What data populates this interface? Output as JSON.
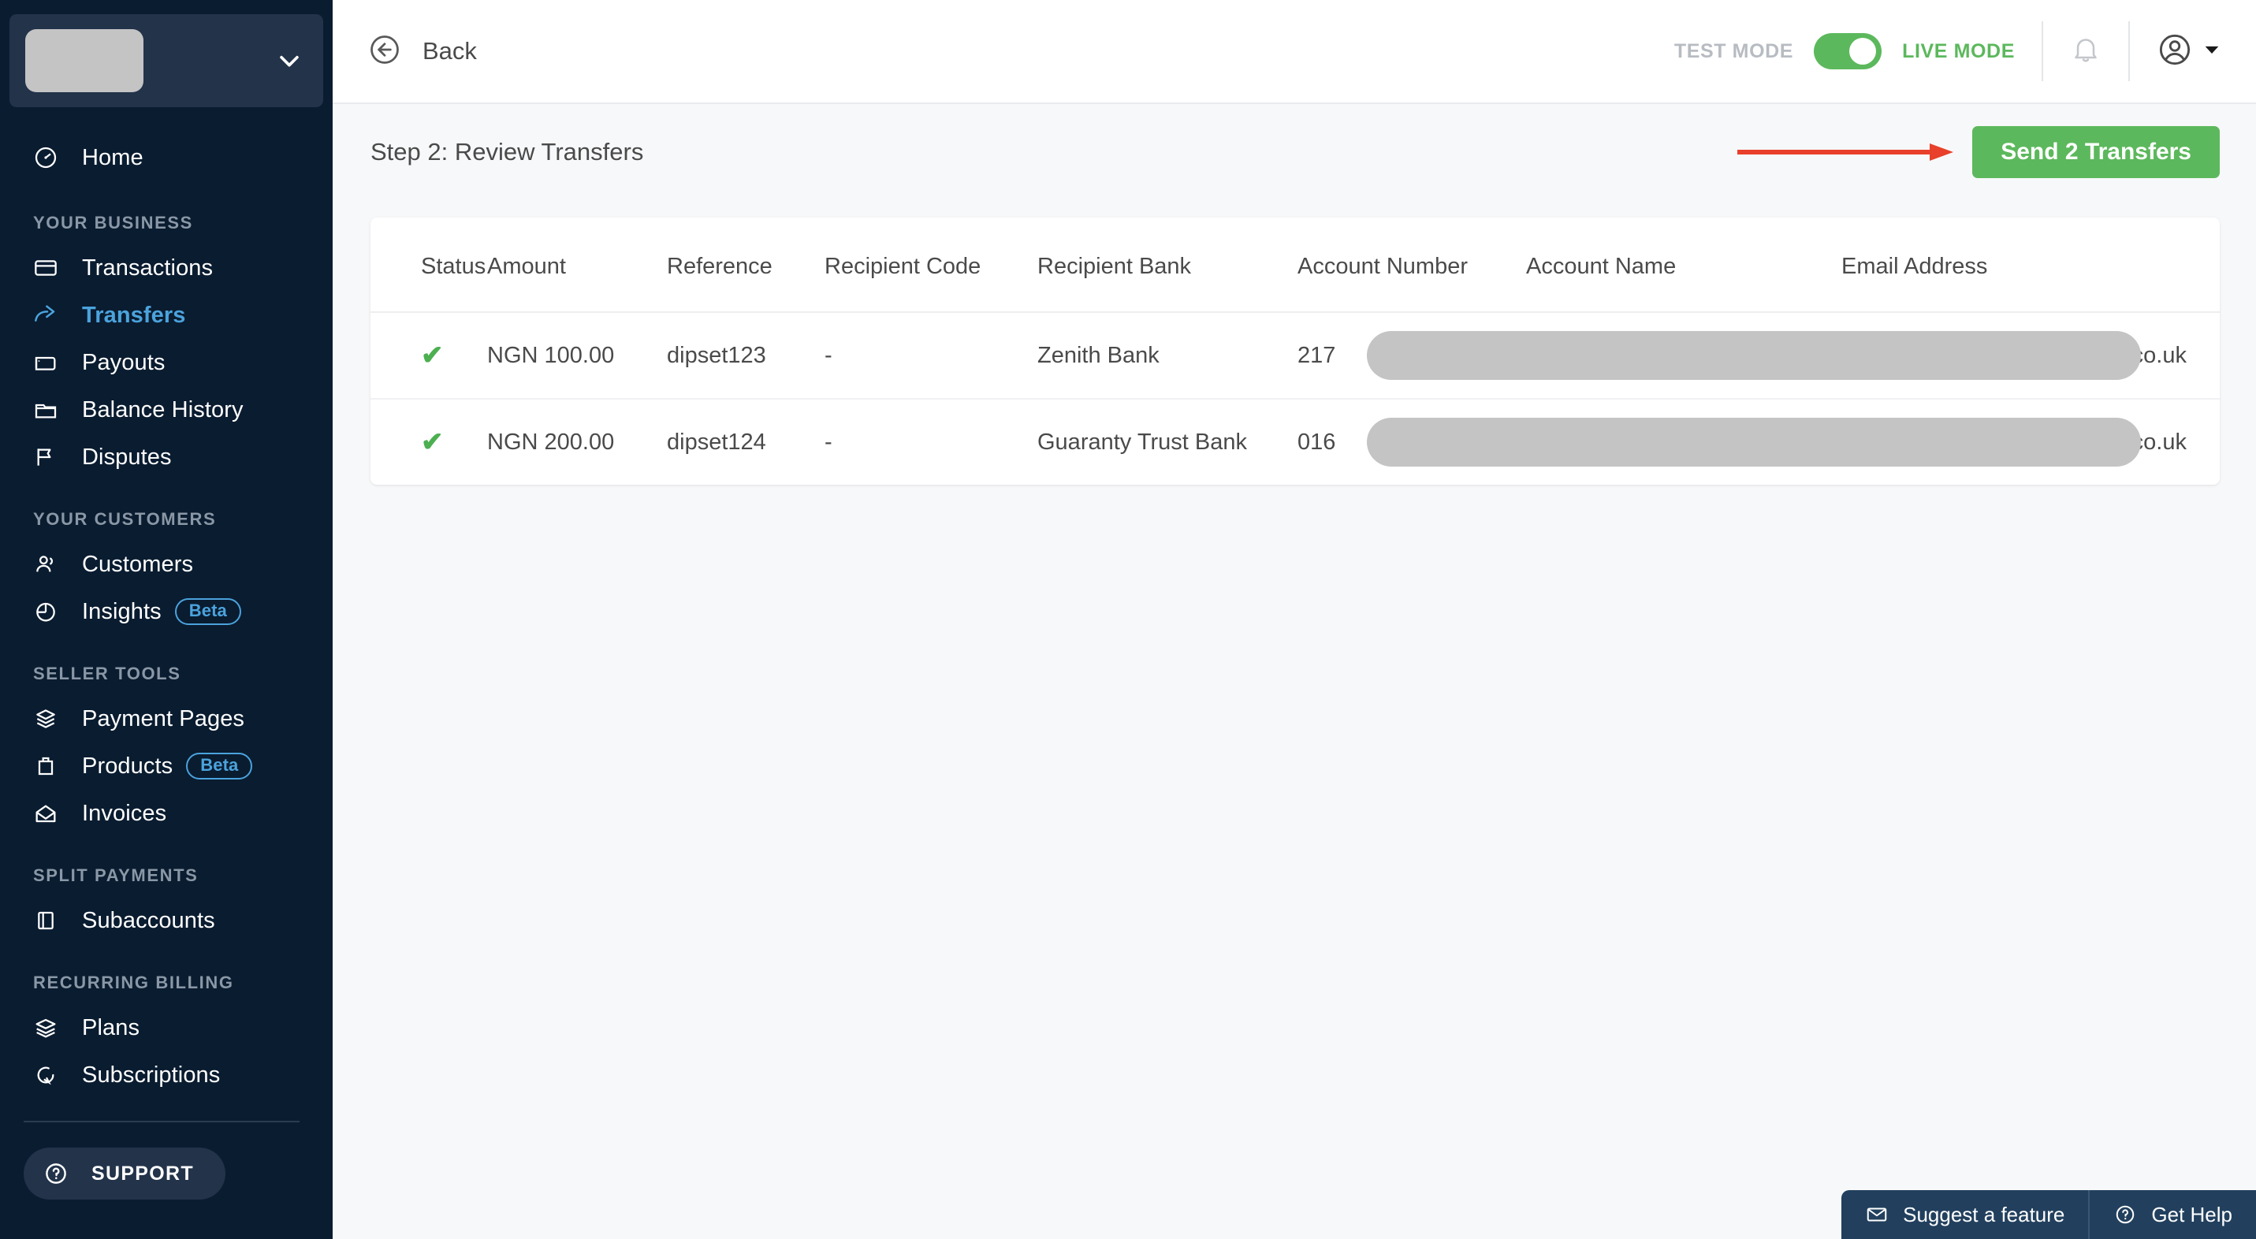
{
  "sidebar": {
    "account_selector": {
      "name": "account-switcher",
      "redacted": true,
      "chevron_icon": "chevron-down-icon"
    },
    "home": {
      "label": "Home",
      "icon": "speedometer-icon"
    },
    "groups": [
      {
        "title": "YOUR BUSINESS",
        "items": [
          {
            "label": "Transactions",
            "icon": "credit-card-icon",
            "active": false
          },
          {
            "label": "Transfers",
            "icon": "share-arrow-icon",
            "active": true
          },
          {
            "label": "Payouts",
            "icon": "wallet-icon",
            "active": false
          },
          {
            "label": "Balance History",
            "icon": "folder-icon",
            "active": false
          },
          {
            "label": "Disputes",
            "icon": "flag-icon",
            "active": false
          }
        ]
      },
      {
        "title": "YOUR CUSTOMERS",
        "items": [
          {
            "label": "Customers",
            "icon": "users-icon",
            "active": false
          },
          {
            "label": "Insights",
            "icon": "pie-chart-icon",
            "active": false,
            "badge": "Beta"
          }
        ]
      },
      {
        "title": "SELLER TOOLS",
        "items": [
          {
            "label": "Payment Pages",
            "icon": "box-icon",
            "active": false
          },
          {
            "label": "Products",
            "icon": "bag-icon",
            "active": false,
            "badge": "Beta"
          },
          {
            "label": "Invoices",
            "icon": "envelope-open-icon",
            "active": false
          }
        ]
      },
      {
        "title": "SPLIT PAYMENTS",
        "items": [
          {
            "label": "Subaccounts",
            "icon": "notebook-icon",
            "active": false
          }
        ]
      },
      {
        "title": "RECURRING BILLING",
        "items": [
          {
            "label": "Plans",
            "icon": "layers-icon",
            "active": false
          },
          {
            "label": "Subscriptions",
            "icon": "refresh-icon",
            "active": false
          }
        ]
      }
    ],
    "support": {
      "label": "SUPPORT",
      "icon": "question-circle-icon"
    }
  },
  "topbar": {
    "back": {
      "label": "Back",
      "icon": "arrow-left-circle-icon"
    },
    "mode": {
      "off_label": "TEST MODE",
      "on_label": "LIVE MODE",
      "state": "live",
      "accent": "#5cb85c"
    },
    "notifications_icon": "bell-icon",
    "account_icon": "user-circle-icon",
    "account_caret_icon": "caret-down-icon"
  },
  "page": {
    "title": "Step 2: Review Transfers",
    "send_button": {
      "label": "Send 2 Transfers",
      "color": "#5cb85c"
    },
    "annotation_arrow": {
      "color": "#e8402a",
      "direction": "right"
    }
  },
  "table": {
    "columns": [
      "Status",
      "Amount",
      "Reference",
      "Recipient Code",
      "Recipient Bank",
      "Account Number",
      "Account Name",
      "Email Address"
    ],
    "rows": [
      {
        "status": "✔",
        "status_color": "#4caf50",
        "amount": "NGN 100.00",
        "reference": "dipset123",
        "recipient_code": "-",
        "recipient_bank": "Zenith Bank",
        "account_number": "217",
        "account_number_redacted": true,
        "account_name": "",
        "account_name_redacted": true,
        "email_suffix": ".co.uk",
        "email_redacted": true
      },
      {
        "status": "✔",
        "status_color": "#4caf50",
        "amount": "NGN 200.00",
        "reference": "dipset124",
        "recipient_code": "-",
        "recipient_bank": "Guaranty Trust Bank",
        "account_number": "016",
        "account_number_redacted": true,
        "account_name": "",
        "account_name_redacted": true,
        "email_suffix": ".co.uk",
        "email_redacted": true
      }
    ]
  },
  "help_dock": {
    "suggest": {
      "label": "Suggest a feature",
      "icon": "envelope-icon"
    },
    "get_help": {
      "label": "Get Help",
      "icon": "question-circle-icon"
    }
  }
}
